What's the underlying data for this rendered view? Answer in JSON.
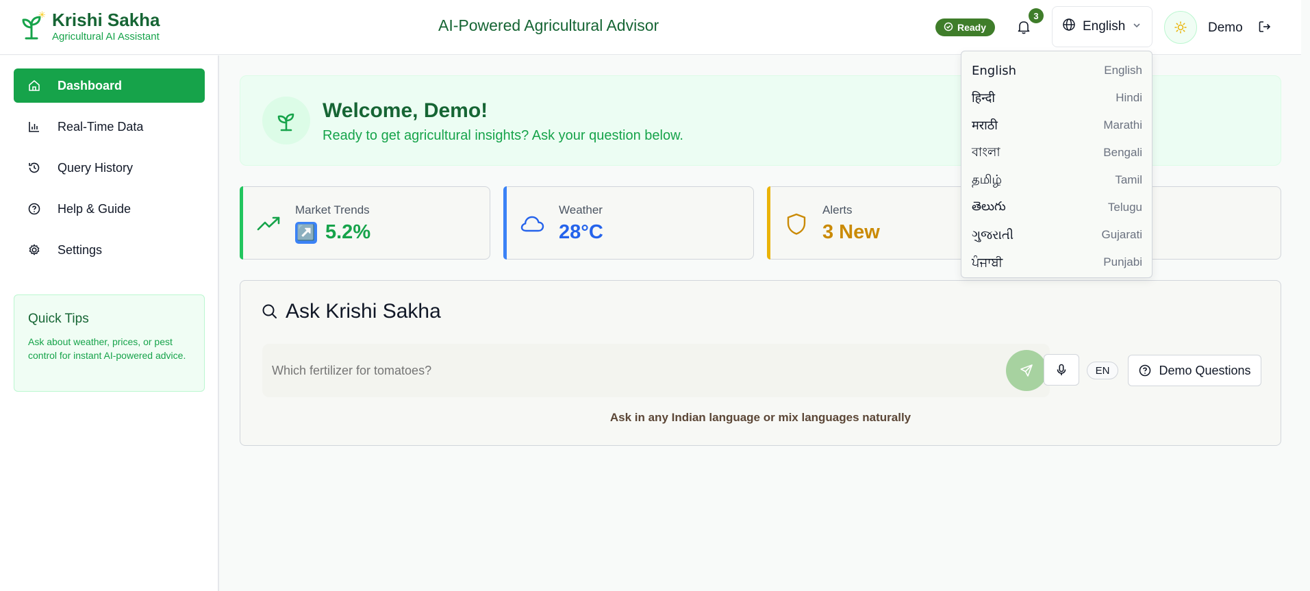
{
  "header": {
    "brand_title": "Krishi Sakha",
    "brand_subtitle": "Agricultural AI Assistant",
    "center_title": "AI-Powered Agricultural Advisor",
    "status_label": "Ready",
    "notification_count": "3",
    "language_label": "English",
    "user_name": "Demo"
  },
  "sidebar": {
    "items": [
      {
        "label": "Dashboard",
        "icon": "home-icon",
        "active": true
      },
      {
        "label": "Real-Time Data",
        "icon": "bar-chart-icon"
      },
      {
        "label": "Query History",
        "icon": "history-icon"
      },
      {
        "label": "Help & Guide",
        "icon": "help-icon"
      },
      {
        "label": "Settings",
        "icon": "gear-icon"
      }
    ],
    "tips": {
      "title": "Quick Tips",
      "body": "Ask about weather, prices, or pest control for instant AI-powered advice."
    }
  },
  "welcome": {
    "title": "Welcome, Demo!",
    "subtitle": "Ready to get agricultural insights? Ask your question below."
  },
  "stats": [
    {
      "label": "Market Trends",
      "value": "5.2%",
      "emoji": "↗️",
      "color": "#16a34a",
      "icon": "trending-up-icon"
    },
    {
      "label": "Weather",
      "value": "28°C",
      "color": "#2563eb",
      "icon": "cloud-icon"
    },
    {
      "label": "Alerts",
      "value": "3 New",
      "color": "#ca8a04",
      "icon": "shield-icon"
    }
  ],
  "ask": {
    "title": "Ask Krishi Sakha",
    "placeholder": "Which fertilizer for tomatoes?",
    "lang_badge": "EN",
    "demo_label": "Demo Questions",
    "hint": "Ask in any Indian language or mix languages naturally"
  },
  "language_dropdown": [
    {
      "native": "English",
      "english": "English"
    },
    {
      "native": "हिन्दी",
      "english": "Hindi"
    },
    {
      "native": "मराठी",
      "english": "Marathi"
    },
    {
      "native": "বাংলা",
      "english": "Bengali"
    },
    {
      "native": "தமிழ்",
      "english": "Tamil"
    },
    {
      "native": "తెలుగు",
      "english": "Telugu"
    },
    {
      "native": "ગુજરાતી",
      "english": "Gujarati"
    },
    {
      "native": "ਪੰਜਾਬੀ",
      "english": "Punjabi"
    }
  ]
}
